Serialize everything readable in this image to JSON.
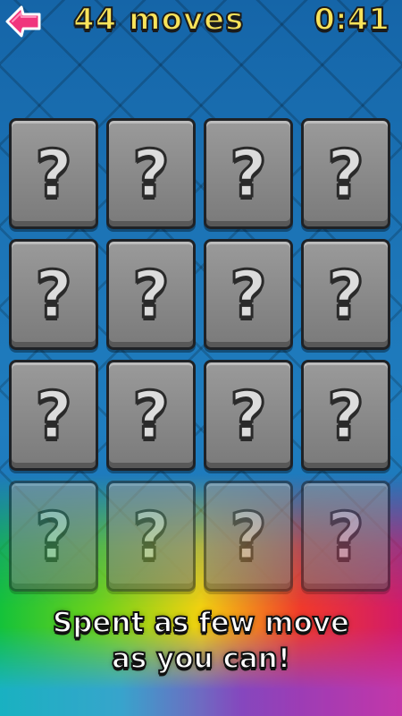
{
  "header": {
    "moves_text": "44 moves",
    "timer_text": "0:41",
    "back_icon": "back-arrow-icon"
  },
  "board": {
    "columns": 4,
    "rows": 4,
    "card_symbol": "?",
    "cards": [
      {
        "state": "hidden"
      },
      {
        "state": "hidden"
      },
      {
        "state": "hidden"
      },
      {
        "state": "hidden"
      },
      {
        "state": "hidden"
      },
      {
        "state": "hidden"
      },
      {
        "state": "hidden"
      },
      {
        "state": "hidden"
      },
      {
        "state": "hidden"
      },
      {
        "state": "hidden"
      },
      {
        "state": "hidden"
      },
      {
        "state": "hidden"
      },
      {
        "state": "hidden"
      },
      {
        "state": "hidden"
      },
      {
        "state": "hidden"
      },
      {
        "state": "hidden"
      }
    ]
  },
  "caption": {
    "line1": "Spent as few move",
    "line2": "as you can!"
  },
  "colors": {
    "background": "#1f6fae",
    "counter_text": "#f9e35a",
    "card_gray": "#8a8a8a",
    "back_button": "#f0357d"
  }
}
